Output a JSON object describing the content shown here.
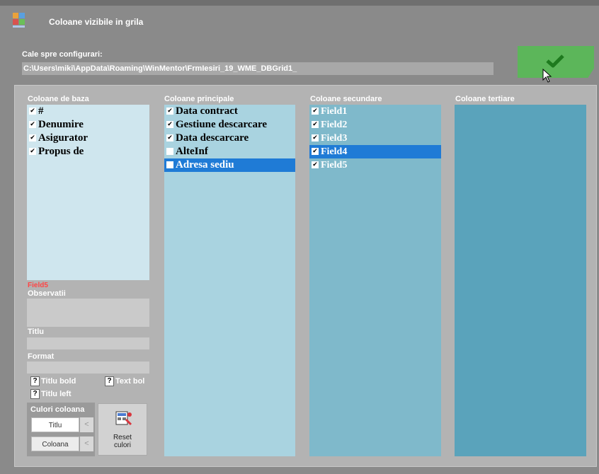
{
  "window": {
    "title": "Coloane vizibile in grila"
  },
  "config": {
    "path_label": "Cale spre configurari:",
    "path_value": "C:\\Users\\miki\\AppData\\Roaming\\WinMentor\\FrmIesiri_19_WME_DBGrid1_"
  },
  "ok_icon": "checkmark-icon",
  "columns": [
    {
      "title": "Coloane de baza",
      "items": [
        {
          "label": "#",
          "checked": true,
          "selected": false
        },
        {
          "label": "Denumire",
          "checked": true,
          "selected": false
        },
        {
          "label": "Asigurator",
          "checked": true,
          "selected": false
        },
        {
          "label": "Propus de",
          "checked": true,
          "selected": false
        }
      ]
    },
    {
      "title": "Coloane principale",
      "items": [
        {
          "label": "Data contract",
          "checked": true,
          "selected": false
        },
        {
          "label": "Gestiune descarcare",
          "checked": true,
          "selected": false
        },
        {
          "label": "Data descarcare",
          "checked": true,
          "selected": false
        },
        {
          "label": "AlteInf",
          "checked": false,
          "selected": false
        },
        {
          "label": "Adresa sediu",
          "checked": false,
          "selected": true
        }
      ]
    },
    {
      "title": "Coloane secundare",
      "items": [
        {
          "label": "Field1",
          "checked": true,
          "selected": false
        },
        {
          "label": "Field2",
          "checked": true,
          "selected": false
        },
        {
          "label": "Field3",
          "checked": true,
          "selected": false
        },
        {
          "label": "Field4",
          "checked": true,
          "selected": true
        },
        {
          "label": "Field5",
          "checked": true,
          "selected": false
        }
      ]
    },
    {
      "title": "Coloane tertiare",
      "items": []
    }
  ],
  "details": {
    "current_field": "Field5",
    "observatii_label": "Observatii",
    "titlu_label": "Titlu",
    "format_label": "Format",
    "titlu_bold": "Titlu bold",
    "text_bold": "Text bol",
    "titlu_left": "Titlu left",
    "question_mark": "?"
  },
  "colors": {
    "label": "Culori coloana",
    "titlu_btn": "Titlu",
    "coloana_btn": "Coloana",
    "arrow": "<",
    "reset_line1": "Reset",
    "reset_line2": "culori"
  },
  "palette": {
    "accent_selected": "#1f7bd6",
    "ok_green": "#5cb65a",
    "field_red": "#ff4545"
  }
}
